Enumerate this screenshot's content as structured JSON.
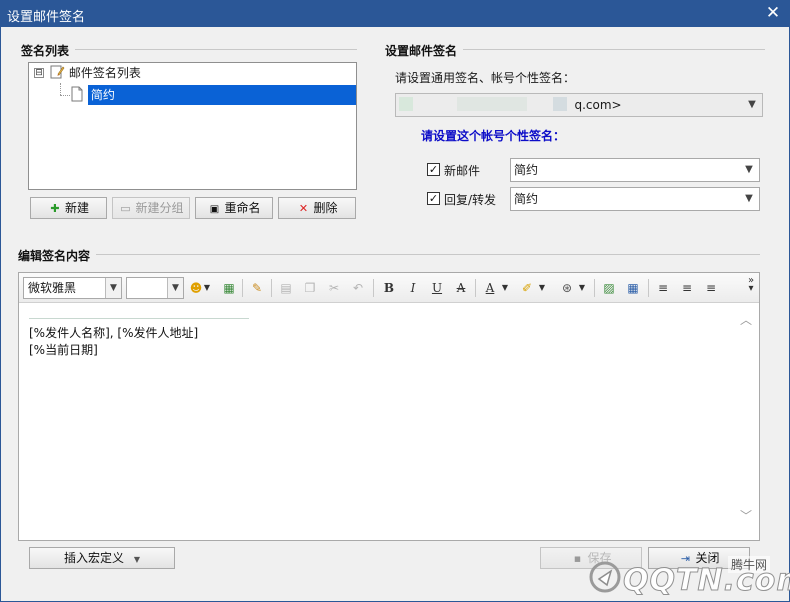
{
  "window": {
    "title": "设置邮件签名",
    "close_glyph": "✕"
  },
  "signature_list": {
    "section_title": "签名列表",
    "tree": {
      "root_label": "邮件签名列表",
      "expander": "⊟",
      "children": [
        {
          "label": "简约",
          "selected": true
        }
      ]
    },
    "buttons": {
      "new": "新建",
      "new_group": "新建分组",
      "rename": "重命名",
      "delete": "删除"
    }
  },
  "signature_settings": {
    "section_title": "设置邮件签名",
    "general_prompt": "请设置通用签名、帐号个性签名：",
    "account_value": "q.com>",
    "account_prompt": "请设置这个帐号个性签名：",
    "new_mail": {
      "checked": true,
      "label": "新邮件",
      "value": "简约"
    },
    "reply_forward": {
      "checked": true,
      "label": "回复/转发",
      "value": "简约"
    }
  },
  "editor": {
    "section_title": "编辑签名内容",
    "font_name": "微软雅黑",
    "font_size": "",
    "content_lines": [
      "[%发件人名称], [%发件人地址]",
      "[%当前日期]"
    ],
    "toolbar_icons": [
      "emoji-icon",
      "image-insert-icon",
      "format-brush-icon",
      "paste-icon",
      "copy-icon",
      "cut-icon",
      "undo-icon",
      "bold-icon",
      "italic-icon",
      "underline-icon",
      "strikethrough-icon",
      "font-color-icon",
      "highlight-icon",
      "link-icon",
      "image-icon",
      "table-icon",
      "align-left-icon",
      "align-center-icon",
      "align-right-icon",
      "toolbar-overflow-icon"
    ]
  },
  "footer": {
    "insert_macro": "插入宏定义",
    "save": "保存",
    "close": "关闭"
  },
  "watermark": {
    "brand": "QQTN.com",
    "site": "腾牛网"
  },
  "colors": {
    "titlebar": "#2b5797",
    "selection": "#0a62d6",
    "account_label": "#0c0cc8"
  }
}
